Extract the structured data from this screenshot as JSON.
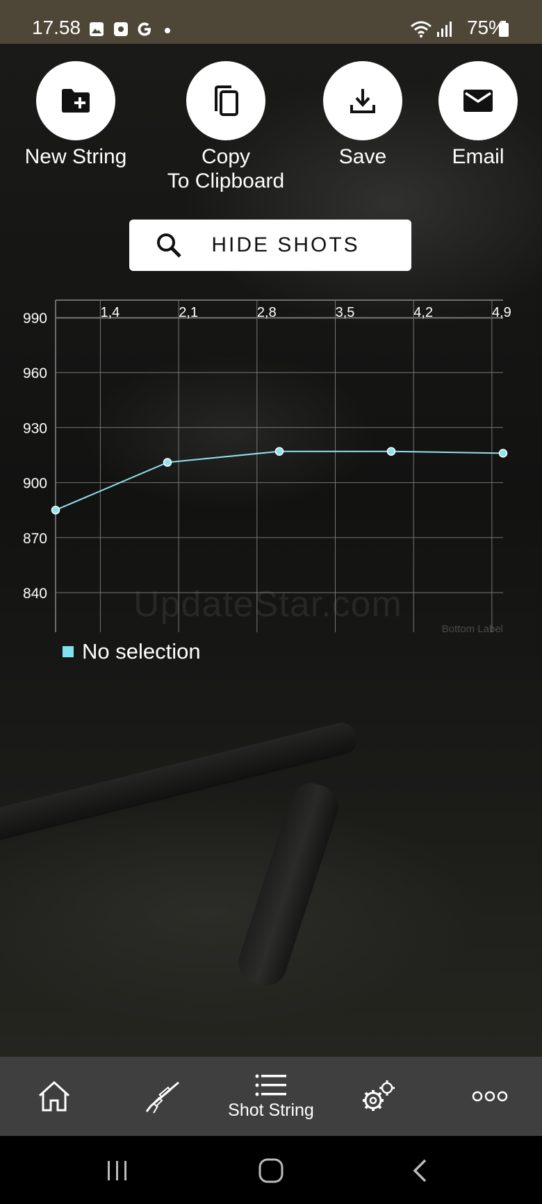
{
  "status_bar": {
    "time": "17.58",
    "battery": "75%",
    "icons": [
      "gallery-icon",
      "screen-record-icon",
      "google-icon",
      "dot-icon",
      "wifi-icon",
      "signal-icon",
      "battery-icon"
    ]
  },
  "actions": {
    "new_string": "New String",
    "copy_line1": "Copy",
    "copy_line2": "To Clipboard",
    "save": "Save",
    "email": "Email"
  },
  "hide_shots_button": "HIDE SHOTS",
  "chart_data": {
    "type": "line",
    "x_tick_labels": [
      "1,4",
      "2,1",
      "2,8",
      "3,5",
      "4,2",
      "4,9"
    ],
    "x_ticks": [
      1.4,
      2.1,
      2.8,
      3.5,
      4.2,
      4.9
    ],
    "xlim": [
      1.0,
      5.0
    ],
    "y_ticks": [
      990,
      960,
      930,
      900,
      870,
      840
    ],
    "ylim": [
      820,
      1000
    ],
    "series": [
      {
        "color": "#8fe3ef",
        "x": [
          1,
          2,
          3,
          4,
          5
        ],
        "y": [
          885,
          911,
          917,
          917,
          916
        ]
      }
    ],
    "grid": true,
    "axis_title_fragment": "Bottom Label",
    "legend": {
      "label": "No selection",
      "position": "bottom-left"
    }
  },
  "watermark": "UpdateStar.com",
  "bottom_nav": {
    "items": [
      {
        "icon": "home-icon",
        "label": ""
      },
      {
        "icon": "rifle-icon",
        "label": ""
      },
      {
        "icon": "list-icon",
        "label": "Shot String"
      },
      {
        "icon": "settings-icon",
        "label": ""
      },
      {
        "icon": "more-icon",
        "label": ""
      }
    ]
  },
  "system_nav": [
    "recent-apps-icon",
    "home-button-icon",
    "back-icon"
  ]
}
